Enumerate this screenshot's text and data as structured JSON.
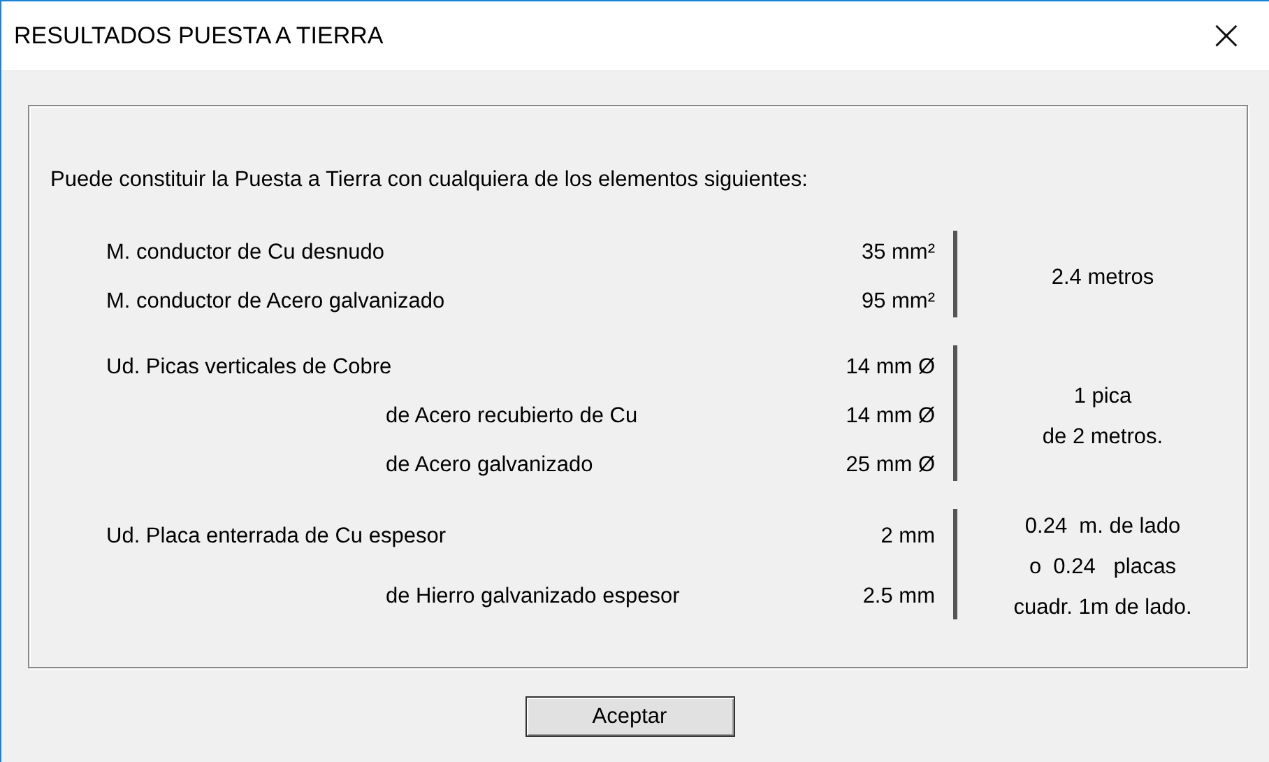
{
  "window": {
    "title": "RESULTADOS PUESTA A TIERRA",
    "close": "×"
  },
  "intro": "Puede constituir la Puesta a Tierra con cualquiera de los elementos siguientes:",
  "groups": [
    {
      "rows": [
        {
          "kind": "main",
          "label": "M. conductor de Cu desnudo",
          "value": "35 mm²"
        },
        {
          "kind": "main",
          "label": "M. conductor de Acero galvanizado",
          "value": "95 mm²"
        }
      ],
      "note": [
        "2.4 metros"
      ]
    },
    {
      "rows": [
        {
          "kind": "main",
          "label": "Ud. Picas verticales de Cobre",
          "value": "14 mm Ø"
        },
        {
          "kind": "sub",
          "label": "de Acero recubierto de Cu",
          "value": "14 mm Ø"
        },
        {
          "kind": "sub",
          "label": "de Acero galvanizado",
          "value": "25 mm Ø"
        }
      ],
      "note": [
        "1 pica",
        "de 2 metros."
      ]
    },
    {
      "rows": [
        {
          "kind": "main",
          "label": "Ud. Placa enterrada de Cu espesor",
          "value": "2 mm"
        },
        {
          "kind": "sub",
          "label": "de Hierro galvanizado espesor",
          "value": "2.5 mm"
        }
      ],
      "note": [
        "0.24  m. de lado",
        "o  0.24   placas",
        "cuadr. 1m de lado."
      ]
    }
  ],
  "button": "Aceptar"
}
